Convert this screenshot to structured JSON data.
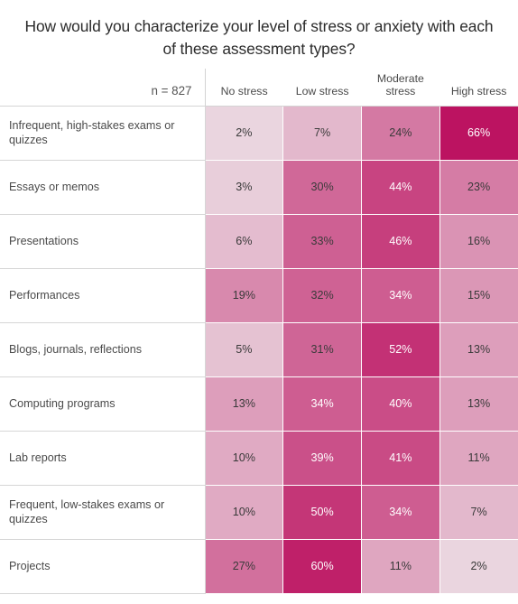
{
  "title": "How would you characterize your level of stress or anxiety with each of these assessment types?",
  "sample_size_label": "n = 827",
  "columns": [
    "No stress",
    "Low stress",
    "Moderate stress",
    "High stress"
  ],
  "rows": [
    {
      "label": "Infrequent, high-stakes exams or quizzes",
      "values": [
        "2%",
        "7%",
        "24%",
        "66%"
      ]
    },
    {
      "label": "Essays or memos",
      "values": [
        "3%",
        "30%",
        "44%",
        "23%"
      ]
    },
    {
      "label": "Presentations",
      "values": [
        "6%",
        "33%",
        "46%",
        "16%"
      ]
    },
    {
      "label": "Performances",
      "values": [
        "19%",
        "32%",
        "34%",
        "15%"
      ]
    },
    {
      "label": "Blogs, journals, reflections",
      "values": [
        "5%",
        "31%",
        "52%",
        "13%"
      ]
    },
    {
      "label": "Computing programs",
      "values": [
        "13%",
        "34%",
        "40%",
        "13%"
      ]
    },
    {
      "label": "Lab reports",
      "values": [
        "10%",
        "39%",
        "41%",
        "11%"
      ]
    },
    {
      "label": "Frequent, low-stakes exams or quizzes",
      "values": [
        "10%",
        "50%",
        "34%",
        "7%"
      ]
    },
    {
      "label": "Projects",
      "values": [
        "27%",
        "60%",
        "11%",
        "2%"
      ]
    }
  ],
  "palette": {
    "min_color": "#f0eeef",
    "max_color": "#bc1361",
    "white_text_threshold": 34
  },
  "chart_data": {
    "type": "heatmap",
    "title": "How would you characterize your level of stress or anxiety with each of these assessment types?",
    "xlabel": "",
    "ylabel": "",
    "annotation": "n = 827",
    "columns": [
      "No stress",
      "Low stress",
      "Moderate stress",
      "High stress"
    ],
    "rows": [
      "Infrequent, high-stakes exams or quizzes",
      "Essays or memos",
      "Presentations",
      "Performances",
      "Blogs, journals, reflections",
      "Computing programs",
      "Lab reports",
      "Frequent, low-stakes exams or quizzes",
      "Projects"
    ],
    "values": [
      [
        2,
        7,
        24,
        66
      ],
      [
        3,
        30,
        44,
        23
      ],
      [
        6,
        33,
        46,
        16
      ],
      [
        19,
        32,
        34,
        15
      ],
      [
        5,
        31,
        52,
        13
      ],
      [
        13,
        34,
        40,
        13
      ],
      [
        10,
        39,
        41,
        11
      ],
      [
        10,
        50,
        34,
        7
      ],
      [
        27,
        60,
        11,
        2
      ]
    ],
    "unit": "percent",
    "value_range": [
      0,
      66
    ],
    "colorscale": [
      "#f0eeef",
      "#bc1361"
    ],
    "grid": false,
    "legend": "none"
  }
}
